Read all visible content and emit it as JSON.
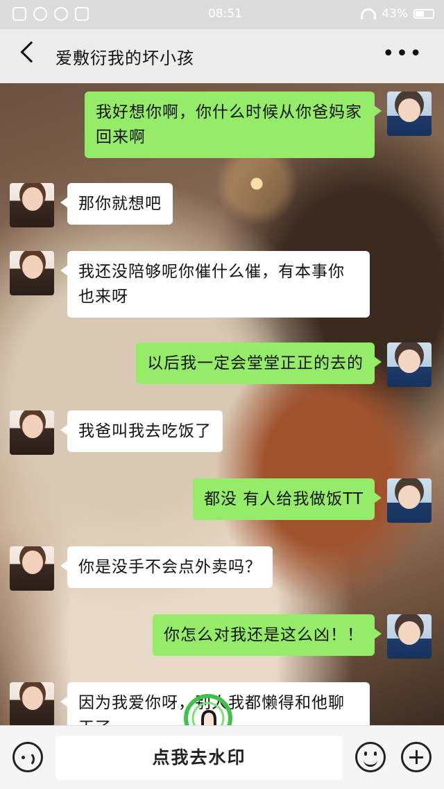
{
  "status_bar": {
    "time": "08:51",
    "battery": "43%"
  },
  "header": {
    "title": "爱敷衍我的坏小孩"
  },
  "messages": [
    {
      "sender": "me",
      "text": "我好想你啊，你什么时候从你爸妈家回来啊"
    },
    {
      "sender": "them",
      "text": "那你就想吧"
    },
    {
      "sender": "them",
      "text": "我还没陪够呢你催什么催，有本事你也来呀"
    },
    {
      "sender": "me",
      "text": "以后我一定会堂堂正正的去的"
    },
    {
      "sender": "them",
      "text": "我爸叫我去吃饭了"
    },
    {
      "sender": "me",
      "text": "都没 有人给我做饭TT"
    },
    {
      "sender": "them",
      "text": "你是没手不会点外卖吗？"
    },
    {
      "sender": "me",
      "text": "你怎么对我还是这么凶！！"
    },
    {
      "sender": "them",
      "text": "因为我爱你呀，别人我都懒得和他聊天了"
    }
  ],
  "input_bar": {
    "placeholder_button": "点我去水印"
  },
  "colors": {
    "my_bubble": "#95ec69",
    "their_bubble": "#ffffff",
    "nav_background": "#ececec"
  },
  "icons": {
    "back": "back-chevron-icon",
    "more": "more-icon",
    "voice": "voice-icon",
    "emoji": "emoji-icon",
    "plus": "plus-icon",
    "hand": "tap-hand-icon"
  }
}
